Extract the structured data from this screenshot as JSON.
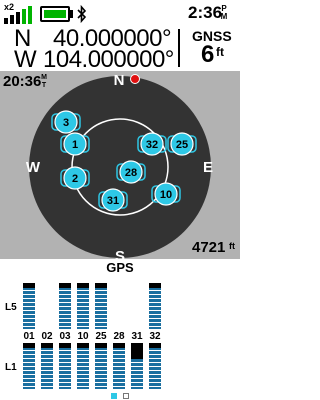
{
  "status": {
    "gps_multiplier": "x2",
    "signal_bars": 4,
    "battery_color": "#00b400",
    "clock": "2:36",
    "ampm_1": "P",
    "ampm_2": "M"
  },
  "position": {
    "lat_hemisphere": "N",
    "latitude": "40.000000°",
    "lon_hemisphere": "W",
    "longitude": "104.000000°",
    "mode": "GNSS",
    "accuracy": "6",
    "accuracy_unit": "ft"
  },
  "sky": {
    "time": "20:36",
    "time_unit_1": "M",
    "time_unit_2": "T",
    "compass": {
      "north": "N",
      "south": "S",
      "east": "E",
      "west": "W"
    },
    "elevation": "4721",
    "elevation_unit": "ft",
    "satellites": [
      {
        "id": "3"
      },
      {
        "id": "1"
      },
      {
        "id": "2"
      },
      {
        "id": "28"
      },
      {
        "id": "31"
      },
      {
        "id": "32"
      },
      {
        "id": "25"
      },
      {
        "id": "10"
      }
    ],
    "satellite_color": "#2ec8e6",
    "ring_color": "#333333"
  },
  "signal": {
    "title": "GPS",
    "band_l5": "L5",
    "band_l1": "L1",
    "satellite_ids": [
      "01",
      "02",
      "03",
      "10",
      "25",
      "28",
      "31",
      "32"
    ],
    "l5_levels": [
      1,
      0,
      1,
      1,
      1,
      0,
      0,
      1
    ],
    "l1_levels": [
      1,
      1,
      1,
      1,
      1,
      1,
      1,
      1
    ],
    "pager": {
      "pages": 2,
      "current": 1
    }
  }
}
